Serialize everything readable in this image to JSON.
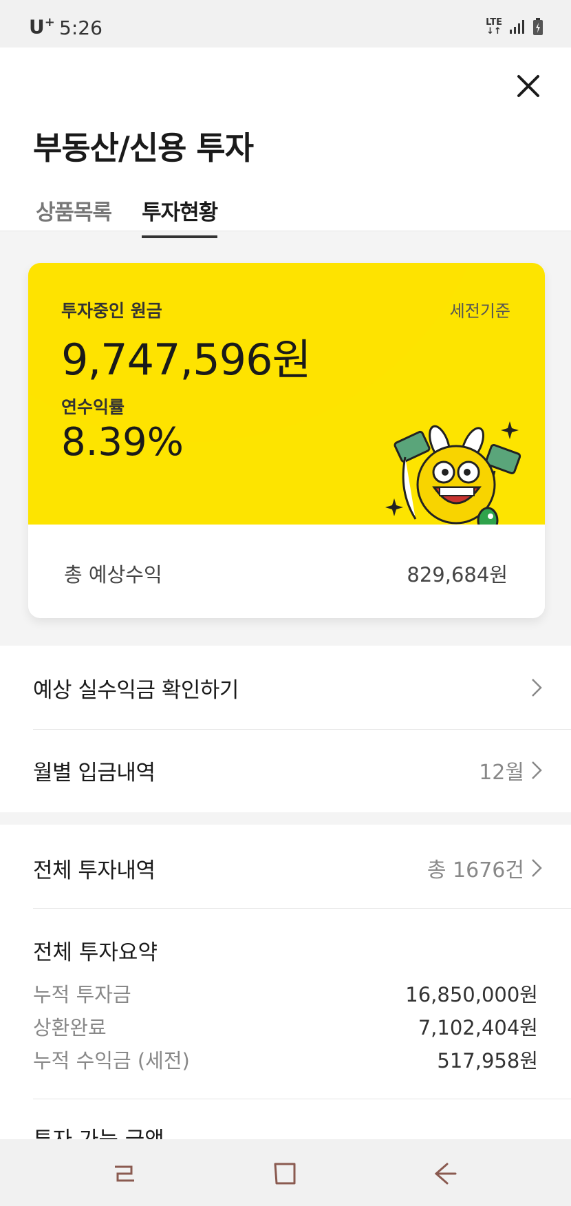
{
  "status_bar": {
    "carrier": "U",
    "carrier_sup": "+",
    "time": "5:26",
    "network_top": "LTE",
    "network_bottom": "↓↑"
  },
  "header": {
    "title": "부동산/신용 투자",
    "tabs": [
      {
        "label": "상품목록",
        "active": false
      },
      {
        "label": "투자현황",
        "active": true
      }
    ]
  },
  "card": {
    "principal_label": "투자중인 원금",
    "pretax_label": "세전기준",
    "principal_value": "9,747,596원",
    "rate_label": "연수익률",
    "rate_value": "8.39%",
    "expected_label": "총 예상수익",
    "expected_value": "829,684원",
    "accent_color": "#fde400"
  },
  "list1": {
    "net_profit_label": "예상 실수익금 확인하기",
    "monthly_label": "월별 입금내역",
    "monthly_value": "12월"
  },
  "list2": {
    "all_label": "전체 투자내역",
    "all_value": "총 1676건",
    "summary_title": "전체 투자요약",
    "summary": [
      {
        "label": "누적 투자금",
        "value": "16,850,000원"
      },
      {
        "label": "상환완료",
        "value": "7,102,404원"
      },
      {
        "label": "누적 수익금 (세전)",
        "value": "517,958원"
      }
    ],
    "partial_next": "투자 가능 금액"
  },
  "icons": {
    "close": "close-icon",
    "chevron": "chevron-right-icon",
    "nav": [
      "recent-apps-icon",
      "home-icon",
      "back-icon"
    ]
  }
}
